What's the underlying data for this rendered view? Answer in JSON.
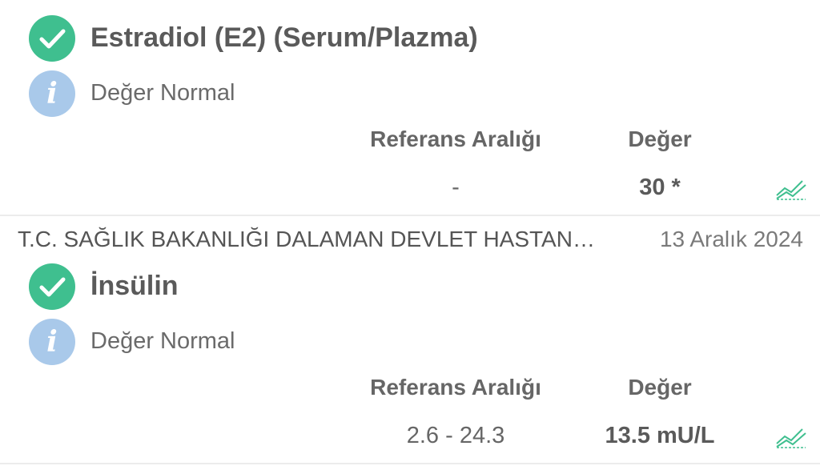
{
  "results": [
    {
      "test_name": "Estradiol (E2) (Serum/Plazma)",
      "status_text": "Değer Normal",
      "ref_header": "Referans Aralığı",
      "value_header": "Değer",
      "ref_range": "-",
      "value": "30 *"
    },
    {
      "test_name": "İnsülin",
      "status_text": "Değer Normal",
      "ref_header": "Referans Aralığı",
      "value_header": "Değer",
      "ref_range": "2.6 - 24.3",
      "value": "13.5 mU/L"
    }
  ],
  "divider": {
    "hospital": "T.C. SAĞLIK BAKANLIĞI DALAMAN DEVLET HASTAN…",
    "date": "13 Aralık 2024"
  },
  "icons": {
    "status": "check-circle-icon",
    "info": "info-icon",
    "trend": "trend-chart-icon"
  },
  "colors": {
    "check": "#3fbf8f",
    "info": "#a9c9ea",
    "trend": "#3fbf8f"
  }
}
